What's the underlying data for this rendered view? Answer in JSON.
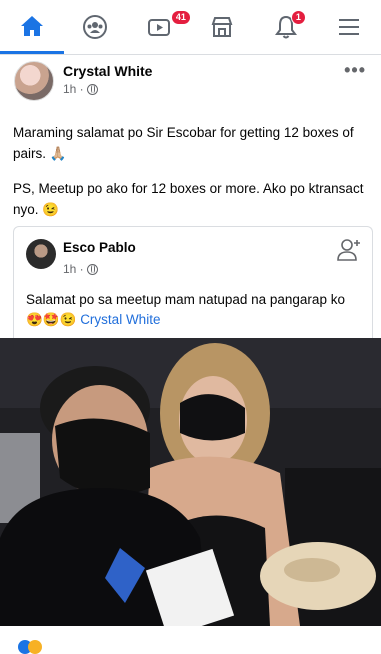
{
  "nav": {
    "items": [
      {
        "name": "home",
        "icon": "home-icon",
        "active": true
      },
      {
        "name": "groups",
        "icon": "groups-icon"
      },
      {
        "name": "watch",
        "icon": "video-icon",
        "badge": "41"
      },
      {
        "name": "marketplace",
        "icon": "marketplace-icon"
      },
      {
        "name": "notifications",
        "icon": "bell-icon",
        "badge": "1"
      },
      {
        "name": "menu",
        "icon": "menu-icon"
      }
    ],
    "accent_color": "#1b74e4",
    "badge_color": "#e41e3f"
  },
  "post": {
    "author": "Crystal White",
    "time": "1h ·",
    "more": "•••",
    "paragraphs": [
      "Maraming salamat po Sir Escobar for getting 12 boxes of pairs. 🙏🏼",
      "PS, Meetup po ako for 12 boxes or more. Ako po ktransact nyo. 😉"
    ]
  },
  "shared": {
    "author": "Esco Pablo",
    "time": "1h ·",
    "text": "Salamat po sa meetup mam natupad na pangarap ko 😍🤩😉 ",
    "mention": "Crystal White"
  }
}
